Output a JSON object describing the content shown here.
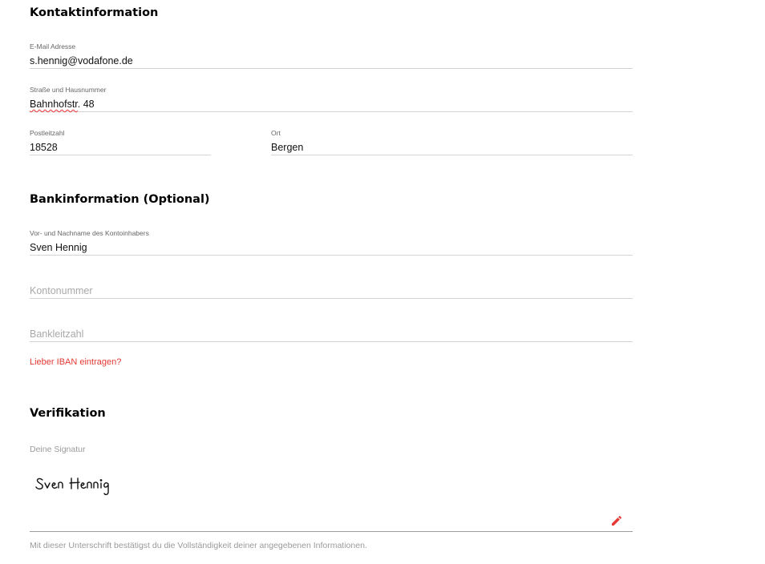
{
  "contact": {
    "title": "Kontaktinformation",
    "email": {
      "label": "E-Mail Adresse",
      "value": "s.hennig@vodafone.de"
    },
    "street": {
      "label": "Straße und Hausnummer",
      "value_misspelled": "Bahnhofstr",
      "value_rest": ". 48"
    },
    "zip": {
      "label": "Postleitzahl",
      "value": "18528"
    },
    "city": {
      "label": "Ort",
      "value": "Bergen"
    }
  },
  "bank": {
    "title": "Bankinformation (Optional)",
    "holder": {
      "label": "Vor- und Nachname des Kontoinhabers",
      "value": "Sven Hennig"
    },
    "account": {
      "placeholder": "Kontonummer"
    },
    "bank_code": {
      "placeholder": "Bankleitzahl"
    },
    "iban_link": "Lieber IBAN eintragen?"
  },
  "verification": {
    "title": "Verifikation",
    "signature_label": "Deine Signatur",
    "signature_text": "Sven Hennig",
    "disclaimer": "Mit dieser Unterschrift bestätigst du die Vollständigkeit deiner angegebenen Informationen."
  },
  "colors": {
    "accent": "#e53935",
    "field_line": "#d4d4d4",
    "muted_text": "#9a9a9a"
  },
  "icons": {
    "edit": "pencil-icon"
  }
}
